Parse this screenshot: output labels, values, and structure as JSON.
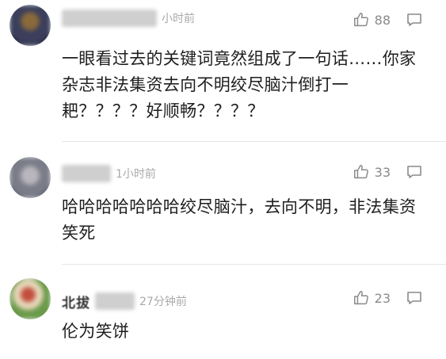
{
  "comments": [
    {
      "name_visible": "",
      "time": "小时前",
      "likes": "88",
      "text": "一眼看过去的关键词竟然组成了一句话……你家杂志非法集资去向不明绞尽脑汁倒打一耙？？？？好顺畅？？？？",
      "avatar_colors": [
        "#3b3f5c",
        "#8a6a3a",
        "#2a2d45"
      ]
    },
    {
      "name_visible": "",
      "time": "1小时前",
      "likes": "33",
      "text": "哈哈哈哈哈哈哈绞尽脑汁，去向不明，非法集资笑死",
      "avatar_colors": [
        "#7a7d88",
        "#b9b6bd",
        "#5e6270"
      ]
    },
    {
      "name_visible": "北拔",
      "time": "27分钟前",
      "likes": "23",
      "text": "伦为笑饼",
      "avatar_colors": [
        "#6a9a4a",
        "#c24f3e",
        "#e6d6b8"
      ]
    }
  ],
  "icons": {
    "like": "thumbs-up-icon",
    "reply": "comment-bubble-icon"
  },
  "colors": {
    "meta_gray": "#a9a9a9",
    "icon_gray": "#8a8a8a",
    "divider": "#e6e6e6"
  }
}
